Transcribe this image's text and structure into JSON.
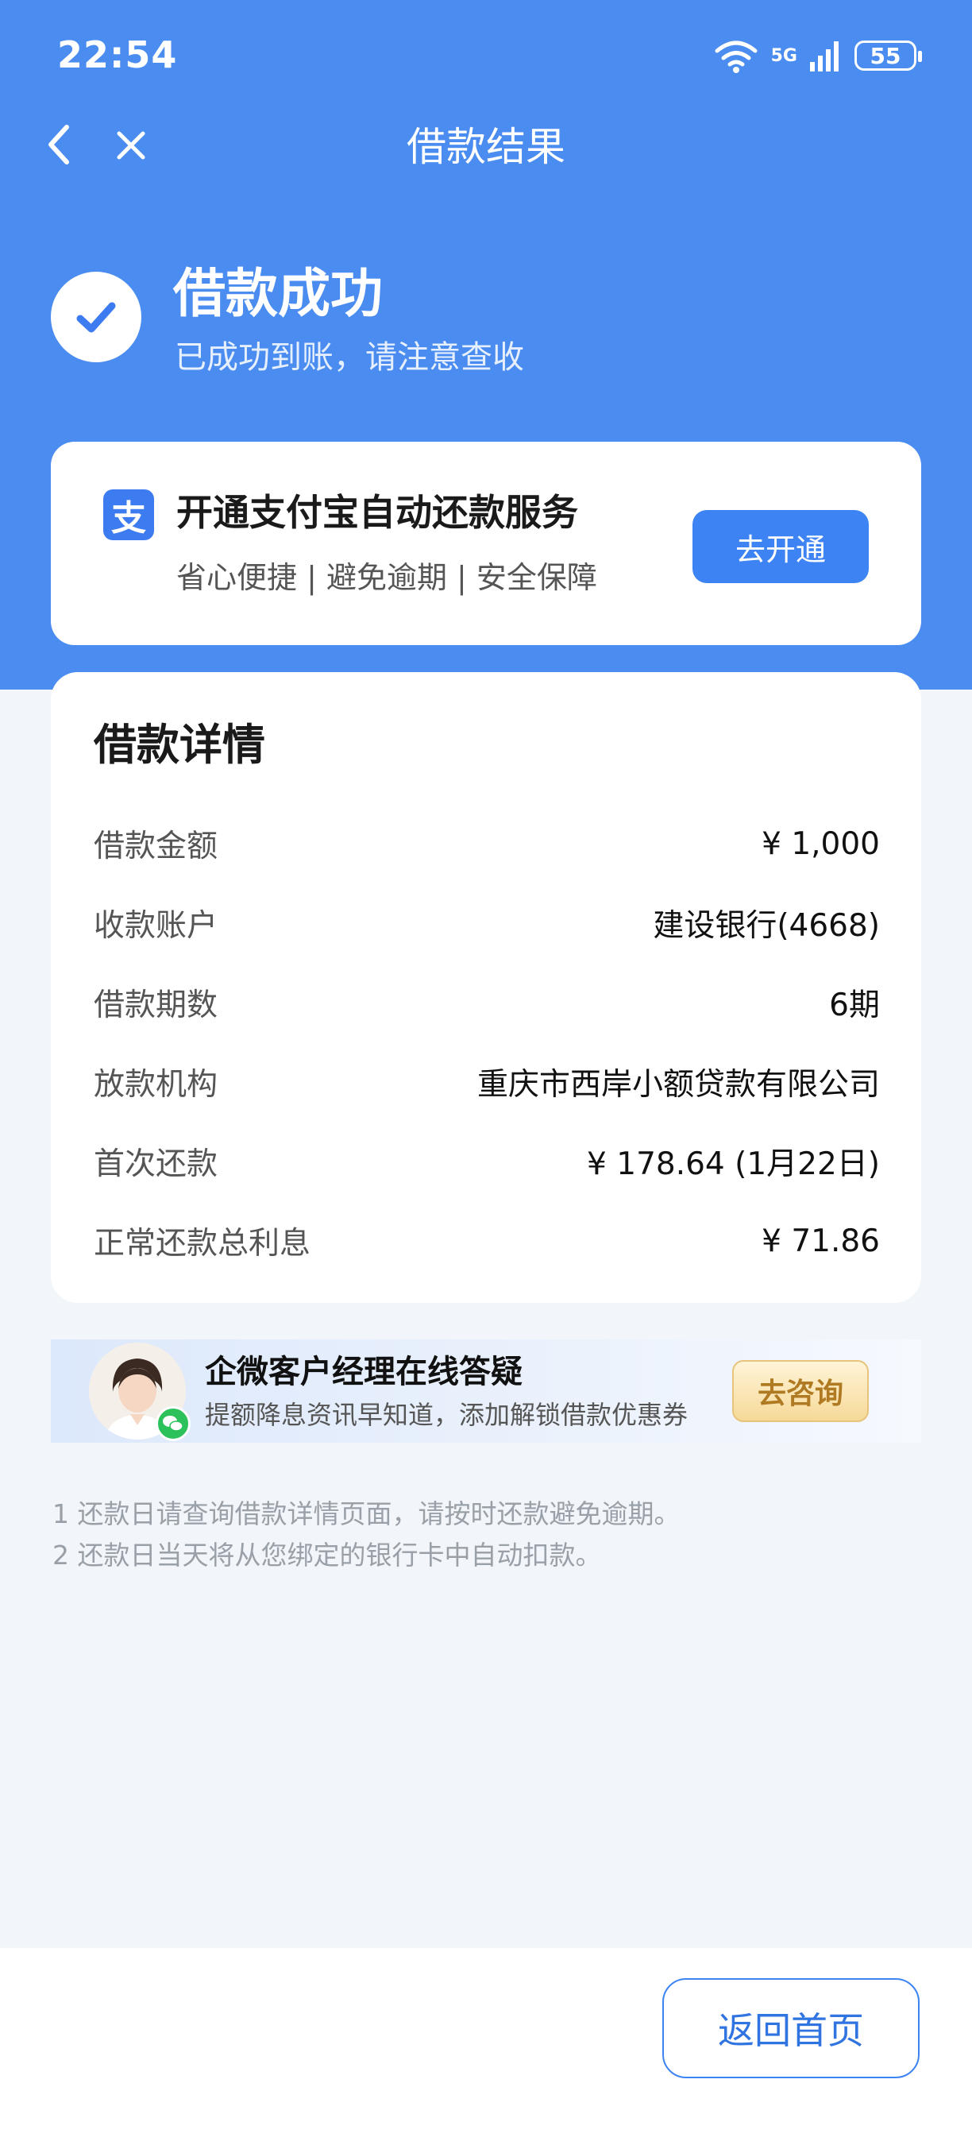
{
  "status_bar": {
    "time": "22:54",
    "network": "5G",
    "battery": "55"
  },
  "nav": {
    "title": "借款结果"
  },
  "success": {
    "title": "借款成功",
    "subtitle": "已成功到账，请注意查收"
  },
  "promo": {
    "logo_char": "支",
    "title": "开通支付宝自动还款服务",
    "subtitle": "省心便捷 | 避免逾期 | 安全保障",
    "button": "去开通"
  },
  "details": {
    "title": "借款详情",
    "rows": [
      {
        "label": "借款金额",
        "value": "¥ 1,000"
      },
      {
        "label": "收款账户",
        "value": "建设银行(4668)"
      },
      {
        "label": "借款期数",
        "value": "6期"
      },
      {
        "label": "放款机构",
        "value": "重庆市西岸小额贷款有限公司"
      },
      {
        "label": "首次还款",
        "value": "¥ 178.64 (1月22日)"
      },
      {
        "label": "正常还款总利息",
        "value": "¥ 71.86"
      }
    ]
  },
  "consult": {
    "title": "企微客户经理在线答疑",
    "subtitle": "提额降息资讯早知道，添加解锁借款优惠券",
    "button": "去咨询"
  },
  "notes": [
    "1 还款日请查询借款详情页面，请按时还款避免逾期。",
    "2 还款日当天将从您绑定的银行卡中自动扣款。"
  ],
  "footer": {
    "home_button": "返回首页"
  },
  "colors": {
    "brand_blue": "#4A8CF0",
    "button_blue": "#3D83F3",
    "consult_gold": "#F6D998"
  }
}
